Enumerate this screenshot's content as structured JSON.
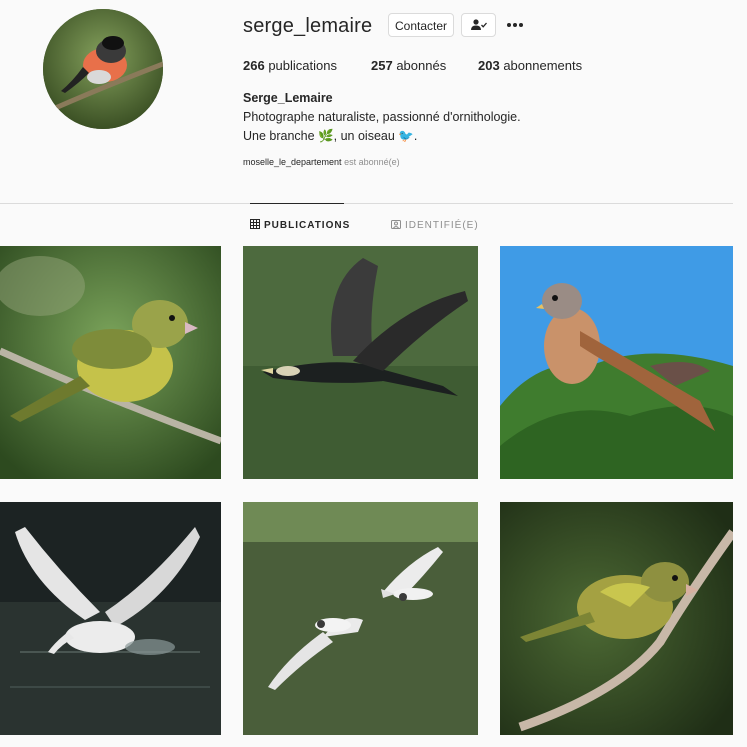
{
  "profile": {
    "username": "serge_lemaire",
    "contact_label": "Contacter",
    "following_icon": "person-check-icon",
    "more_icon": "more-dots-icon",
    "stats": {
      "posts_count": "266",
      "posts_label": "publications",
      "followers_count": "257",
      "followers_label": "abonnés",
      "following_count": "203",
      "following_label": "abonnements"
    },
    "full_name": "Serge_Lemaire",
    "bio_line1": "Photographe naturaliste, passionné d'ornithologie.",
    "bio_line2_a": "Une branche",
    "bio_line2_b": ", un oiseau",
    "bio_line2_c": ".",
    "bio_emoji1": "🌿",
    "bio_emoji2": "🐦",
    "followed_by_account": "moselle_le_departement",
    "followed_by_text": "est abonné(e)"
  },
  "tabs": [
    {
      "label": "PUBLICATIONS",
      "active": true,
      "icon": "grid-icon"
    },
    {
      "label": "IDENTIFIÉ(E)",
      "active": false,
      "icon": "tagged-icon"
    }
  ],
  "posts": [
    {
      "subject": "greenfinch-on-branch"
    },
    {
      "subject": "cormorant-flying"
    },
    {
      "subject": "kestrel-on-foliage"
    },
    {
      "subject": "swan-taking-off"
    },
    {
      "subject": "gulls-flying"
    },
    {
      "subject": "greenfinch-perched"
    }
  ]
}
